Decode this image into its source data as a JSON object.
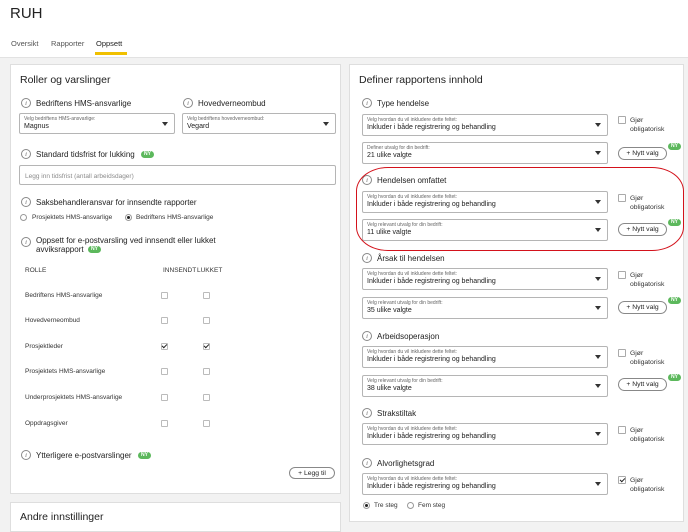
{
  "app": {
    "title": "RUH"
  },
  "tabs": [
    {
      "label": "Oversikt"
    },
    {
      "label": "Rapporter"
    },
    {
      "label": "Oppsett"
    }
  ],
  "left": {
    "title": "Roller og varslinger",
    "hms": {
      "label": "Bedriftens HMS-ansvarlige",
      "caption": "Velg bedriftens HMS-ansvarlige:",
      "value": "Magnus"
    },
    "hvo": {
      "label": "Hovedverneombud",
      "caption": "Velg bedriftens hovedverneombud:",
      "value": "Vegard"
    },
    "deadline": {
      "label": "Standard tidsfrist for lukking",
      "badge": "NY",
      "placeholder": "Legg inn tidsfrist (antall arbeidsdager)"
    },
    "handler": {
      "label": "Saksbehandleransvar for innsendte rapporter",
      "options": [
        "Prosjektets HMS-ansvarlige",
        "Bedriftens HMS-ansvarlige"
      ],
      "selected": 1
    },
    "email": {
      "label": "Oppsett for e-postvarsling ved innsendt eller lukket",
      "label2": "avviksrapport",
      "badge": "NY"
    },
    "table": {
      "headers": [
        "ROLLE",
        "INNSENDT",
        "LUKKET"
      ],
      "rows": [
        {
          "role": "Bedriftens HMS-ansvarlige",
          "innsendt": false,
          "lukket": false
        },
        {
          "role": "Hovedverneombud",
          "innsendt": false,
          "lukket": false
        },
        {
          "role": "Prosjektleder",
          "innsendt": true,
          "lukket": true
        },
        {
          "role": "Prosjektets HMS-ansvarlige",
          "innsendt": false,
          "lukket": false
        },
        {
          "role": "Underprosjektets HMS-ansvarlige",
          "innsendt": false,
          "lukket": false
        },
        {
          "role": "Oppdragsgiver",
          "innsendt": false,
          "lukket": false
        }
      ]
    },
    "extra": {
      "label": "Ytterligere e-postvarslinger",
      "badge": "NY"
    },
    "add_button": "+ Legg til"
  },
  "lower": {
    "title": "Andre innstillinger"
  },
  "right": {
    "title": "Definer rapportens innhold",
    "oblig_label": "Gjør obligatorisk",
    "oblig_line1": "Gjør",
    "oblig_line2": "obligatorisk",
    "new_choice_button": "+ Nytt valg",
    "new_badge": "NY",
    "sections": [
      {
        "label": "Type hendelse",
        "cap1": "Velg hvordan du vil inkludere dette feltet:",
        "val1": "Inkluder i både registrering og behandling",
        "cap2": "Definer utvalg for din bedrift:",
        "val2": "21 ulike valgte",
        "required": false
      },
      {
        "label": "Hendelsen omfattet",
        "cap1": "Velg hvordan du vil inkludere dette feltet:",
        "val1": "Inkluder i både registrering og behandling",
        "cap2": "Velg relevant utvalg for din bedrift:",
        "val2": "11 ulike valgte",
        "required": false
      },
      {
        "label": "Årsak til hendelsen",
        "cap1": "Velg hvordan du vil inkludere dette feltet:",
        "val1": "Inkluder i både registrering og behandling",
        "cap2": "Velg relevant utvalg for din bedrift:",
        "val2": "35 ulike valgte",
        "required": false
      },
      {
        "label": "Arbeidsoperasjon",
        "cap1": "Velg hvordan du vil inkludere dette feltet:",
        "val1": "Inkluder i både registrering og behandling",
        "cap2": "Velg relevant utvalg for din bedrift:",
        "val2": "38 ulike valgte",
        "required": false
      },
      {
        "label": "Strakstiltak",
        "cap1": "Velg hvordan du vil inkludere dette feltet:",
        "val1": "Inkluder i både registrering og behandling",
        "required": false
      },
      {
        "label": "Alvorlighetsgrad",
        "cap1": "Velg hvordan du vil inkludere dette feltet:",
        "val1": "Inkluder i både registrering og behandling",
        "required": true
      }
    ],
    "severity": {
      "options": [
        "Tre steg",
        "Fem steg"
      ],
      "selected": 0
    }
  },
  "colors": {
    "accent": "#f0c000",
    "badge": "#5cb85c",
    "highlight": "#d3121b"
  }
}
